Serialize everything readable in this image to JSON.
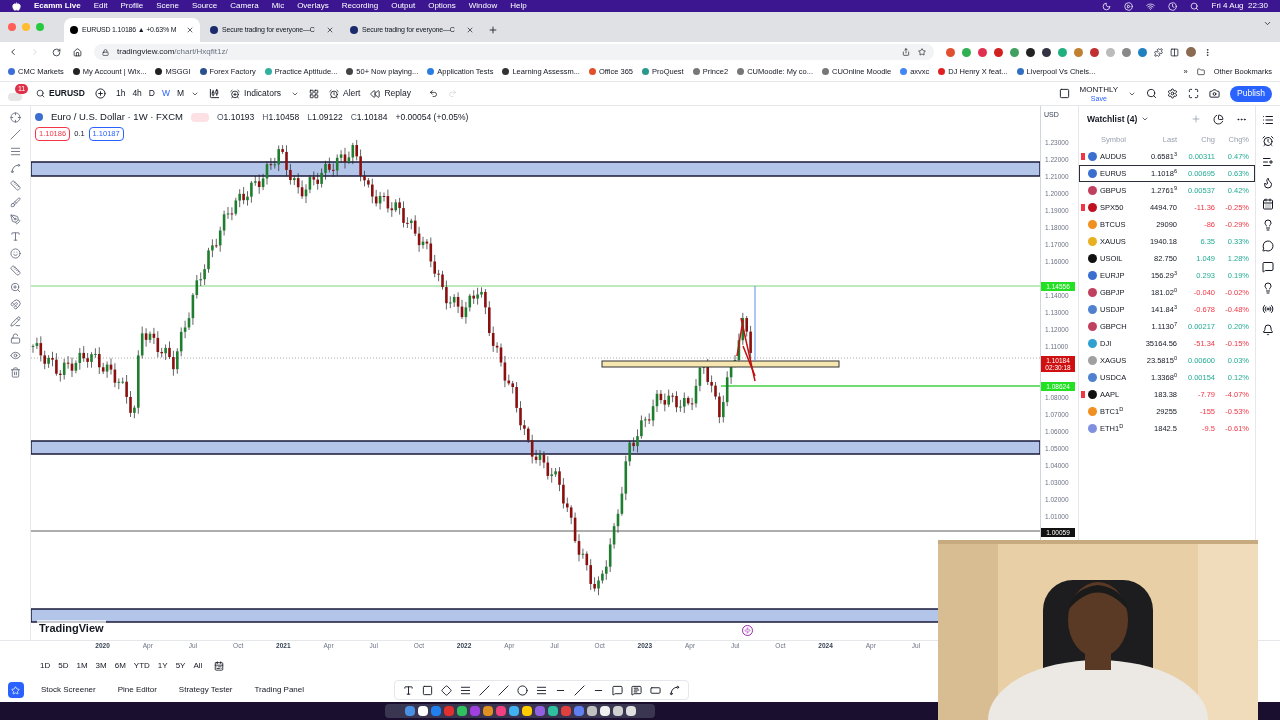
{
  "menubar": {
    "app": "Ecamm Live",
    "items": [
      "Edit",
      "Profile",
      "Scene",
      "Source",
      "Camera",
      "Mic",
      "Overlays",
      "Recording",
      "Output",
      "Options",
      "Window",
      "Help"
    ],
    "clock": "Fri 4 Aug  22:30"
  },
  "browser": {
    "tabs": [
      {
        "title": "EURUSD 1.10186 ▲ +0.63% M",
        "selected": true
      },
      {
        "title": "Secure trading for everyone—C",
        "selected": false
      },
      {
        "title": "Secure trading for everyone—C",
        "selected": false
      }
    ],
    "url_host": "tradingview.com",
    "url_path": "/chart/Hxqfit1z/",
    "bookmarks": [
      {
        "label": "CMC Markets",
        "color": "#3b6fd8"
      },
      {
        "label": "My Account | Wix...",
        "color": "#222222"
      },
      {
        "label": "MSGGI",
        "color": "#222222"
      },
      {
        "label": "Forex Factory",
        "color": "#2a4f8f"
      },
      {
        "label": "Practice Aptitude...",
        "color": "#30b0a0"
      },
      {
        "label": "50+ Now playing...",
        "color": "#444444"
      },
      {
        "label": "Application Tests",
        "color": "#2a7de1"
      },
      {
        "label": "Learning Assessm...",
        "color": "#333333"
      },
      {
        "label": "Office 365",
        "color": "#e0502a"
      },
      {
        "label": "ProQuest",
        "color": "#2a9a8a"
      },
      {
        "label": "Prince2",
        "color": "#777777"
      },
      {
        "label": "CUMoodle: My co...",
        "color": "#777777"
      },
      {
        "label": "CUOnline Moodle",
        "color": "#777777"
      },
      {
        "label": "axvxc",
        "color": "#4285f4"
      },
      {
        "label": "DJ Henry X feat...",
        "color": "#e02020"
      },
      {
        "label": "Liverpool Vs Chels...",
        "color": "#3070c0"
      }
    ],
    "more_bookmarks": "»",
    "other_bookmarks": "Other Bookmarks"
  },
  "toolbar": {
    "notifications": "11",
    "symbol": "EURUSD",
    "intervals": [
      {
        "label": "1h",
        "selected": false
      },
      {
        "label": "4h",
        "selected": false
      },
      {
        "label": "D",
        "selected": false
      },
      {
        "label": "W",
        "selected": true
      },
      {
        "label": "M",
        "selected": false
      }
    ],
    "indicators": "Indicators",
    "alert": "Alert",
    "replay": "Replay",
    "layout_name": "MONTHLY",
    "layout_status": "Save",
    "publish": "Publish"
  },
  "legend": {
    "title": "Euro / U.S. Dollar · 1W · FXCM",
    "ohlc": [
      {
        "label": "O",
        "value": "1.10193"
      },
      {
        "label": "H",
        "value": "1.10458"
      },
      {
        "label": "L",
        "value": "1.09122"
      },
      {
        "label": "C",
        "value": "1.10184"
      }
    ],
    "change": "+0.00054 (+0.05%)",
    "sell": "1.10186",
    "spread": "0.1",
    "buy": "1.10187"
  },
  "price_axis": {
    "currency": "USD",
    "ticks": [
      "1.23000",
      "1.22000",
      "1.21000",
      "1.20000",
      "1.19000",
      "1.18000",
      "1.17000",
      "1.16000",
      "1.14000",
      "1.13000",
      "1.12000",
      "1.11000",
      "1.08000",
      "1.07000",
      "1.06000",
      "1.05000",
      "1.04000",
      "1.03000",
      "1.02000",
      "1.01000"
    ],
    "badges": [
      {
        "lines": [
          "1.14556"
        ],
        "color": "#22e022"
      },
      {
        "lines": [
          "1.10184",
          "02:30:18"
        ],
        "color": "#d01010"
      },
      {
        "lines": [
          "1.08624"
        ],
        "color": "#22e022"
      },
      {
        "lines": [
          "1.00059"
        ],
        "color": "#111111"
      }
    ]
  },
  "logo": "TradingView",
  "time_axis": [
    "2020",
    "Apr",
    "Jul",
    "Oct",
    "2021",
    "Apr",
    "Jul",
    "Oct",
    "2022",
    "Apr",
    "Jul",
    "Oct",
    "2023",
    "Apr",
    "Jul",
    "Oct",
    "2024",
    "Apr",
    "Jul"
  ],
  "ranges": [
    "1D",
    "5D",
    "1M",
    "3M",
    "6M",
    "YTD",
    "1Y",
    "5Y",
    "All"
  ],
  "bottom_tabs": [
    "Stock Screener",
    "Pine Editor",
    "Strategy Tester",
    "Trading Panel"
  ],
  "watchlist": {
    "title": "Watchlist (4)",
    "columns": [
      "Symbol",
      "Last",
      "Chg",
      "Chg%"
    ],
    "rows": [
      {
        "symbol": "AUDUS",
        "last": "0.6581$^{3}$",
        "chg": "0.00311",
        "chg_pct": "0.47%",
        "rising": true,
        "flagged": true,
        "selected": false,
        "color": "#3a6fd0"
      },
      {
        "symbol": "EURUS",
        "last": "1.1018$^{6}$",
        "chg": "0.00695",
        "chg_pct": "0.63%",
        "rising": true,
        "flagged": false,
        "selected": true,
        "color": "#3a6fd0"
      },
      {
        "symbol": "GBPUS",
        "last": "1.2761$^{9}$",
        "chg": "0.00537",
        "chg_pct": "0.42%",
        "rising": true,
        "flagged": false,
        "selected": false,
        "color": "#c04060"
      },
      {
        "symbol": "SPX50",
        "last": "4494.70",
        "chg": "-11.36",
        "chg_pct": "-0.25%",
        "rising": false,
        "flagged": true,
        "selected": false,
        "color": "#c01020"
      },
      {
        "symbol": "BTCUS",
        "last": "29090",
        "chg": "-86",
        "chg_pct": "-0.29%",
        "rising": false,
        "flagged": false,
        "selected": false,
        "color": "#f09020"
      },
      {
        "symbol": "XAUUS",
        "last": "1940.18",
        "chg": "6.35",
        "chg_pct": "0.33%",
        "rising": true,
        "flagged": false,
        "selected": false,
        "color": "#e8b020"
      },
      {
        "symbol": "USOIL",
        "last": "82.750",
        "chg": "1.049",
        "chg_pct": "1.28%",
        "rising": true,
        "flagged": false,
        "selected": false,
        "color": "#111111"
      },
      {
        "symbol": "EURJP",
        "last": "156.29$^{3}$",
        "chg": "0.293",
        "chg_pct": "0.19%",
        "rising": true,
        "flagged": false,
        "selected": false,
        "color": "#3a6fd0"
      },
      {
        "symbol": "GBPJP",
        "last": "181.02$^{0}$",
        "chg": "-0.040",
        "chg_pct": "-0.02%",
        "rising": false,
        "flagged": false,
        "selected": false,
        "color": "#c04060"
      },
      {
        "symbol": "USDJP",
        "last": "141.84$^{3}$",
        "chg": "-0.678",
        "chg_pct": "-0.48%",
        "rising": false,
        "flagged": false,
        "selected": false,
        "color": "#5080d0"
      },
      {
        "symbol": "GBPCH",
        "last": "1.1130$^{7}$",
        "chg": "0.00217",
        "chg_pct": "0.20%",
        "rising": true,
        "flagged": false,
        "selected": false,
        "color": "#c04060"
      },
      {
        "symbol": "DJI",
        "last": "35164.56",
        "chg": "-51.34",
        "chg_pct": "-0.15%",
        "rising": false,
        "flagged": false,
        "selected": false,
        "color": "#30a0d0"
      },
      {
        "symbol": "XAGUS",
        "last": "23.5815$^{0}$",
        "chg": "0.00600",
        "chg_pct": "0.03%",
        "rising": true,
        "flagged": false,
        "selected": false,
        "color": "#a0a0a0"
      },
      {
        "symbol": "USDCA",
        "last": "1.3368$^{0}$",
        "chg": "0.00154",
        "chg_pct": "0.12%",
        "rising": true,
        "flagged": false,
        "selected": false,
        "color": "#5080d0"
      },
      {
        "symbol": "AAPL",
        "last": "183.38",
        "chg": "-7.79",
        "chg_pct": "-4.07%",
        "rising": false,
        "flagged": true,
        "selected": false,
        "color": "#111111"
      },
      {
        "symbol": "BTC1$^{D}$",
        "last": "29255",
        "chg": "-155",
        "chg_pct": "-0.53%",
        "rising": false,
        "flagged": false,
        "selected": false,
        "color": "#f09020"
      },
      {
        "symbol": "ETH1$^{D}$",
        "last": "1842.5",
        "chg": "-9.5",
        "chg_pct": "-0.61%",
        "rising": false,
        "flagged": false,
        "selected": false,
        "color": "#8090e0"
      }
    ]
  }
}
